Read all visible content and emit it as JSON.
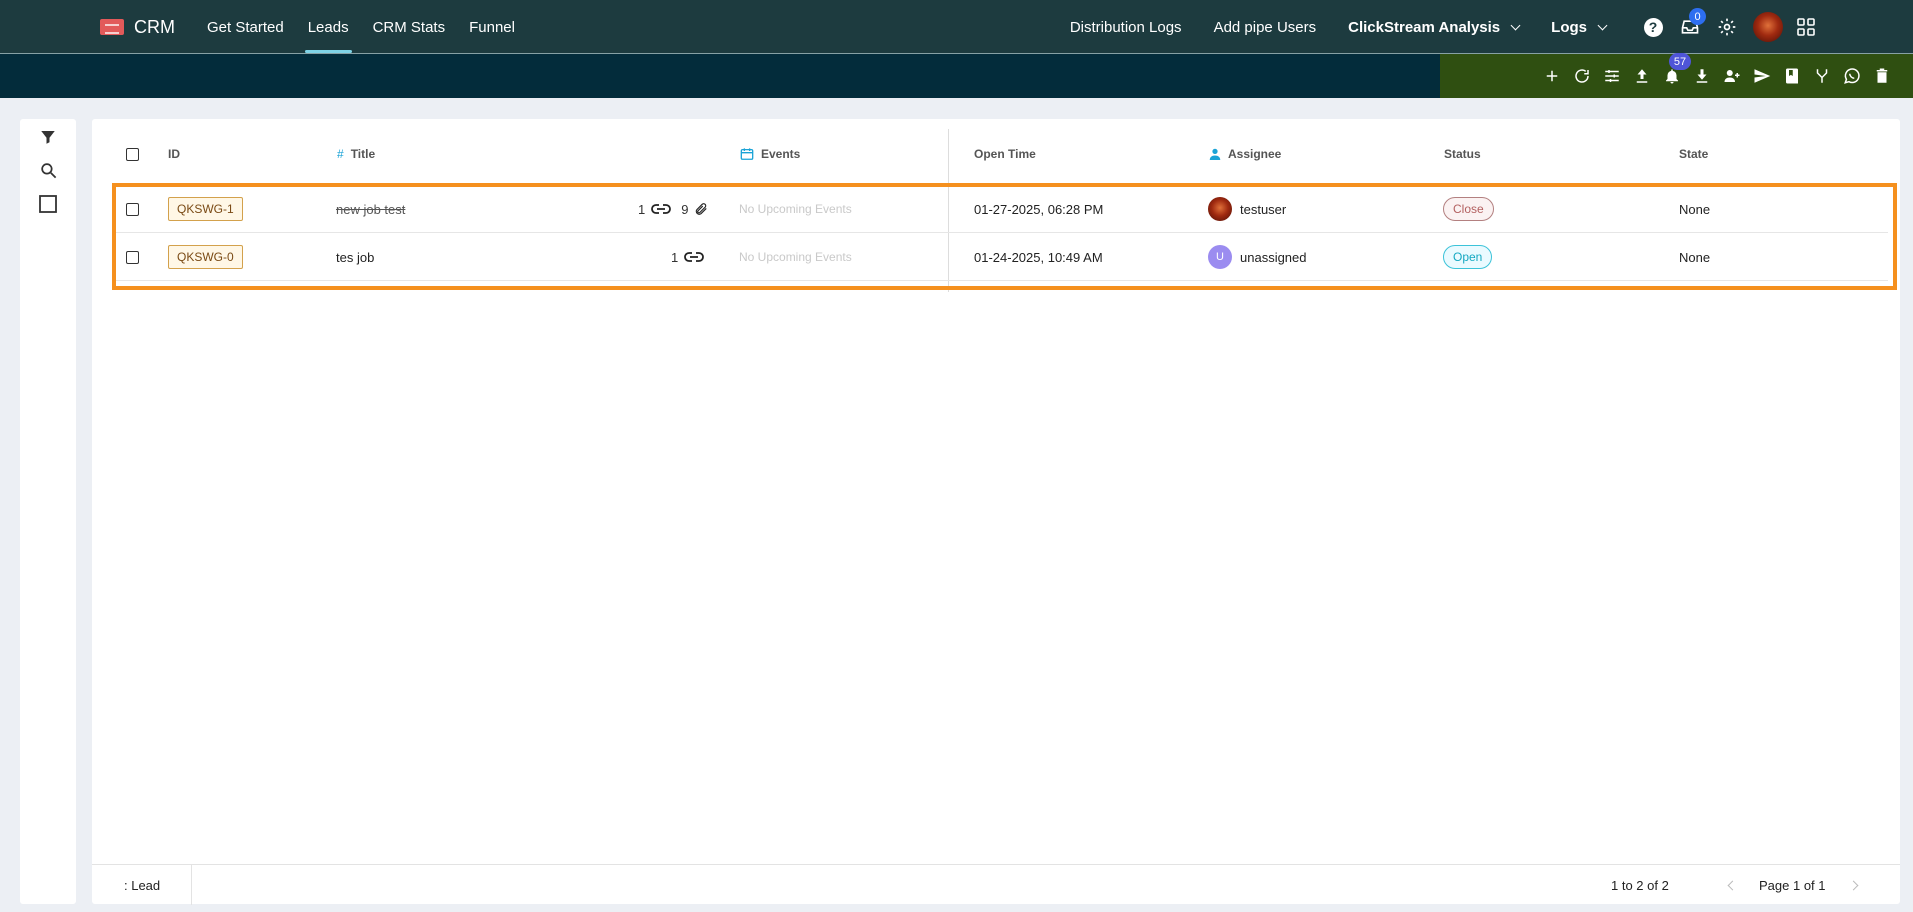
{
  "app": {
    "brand_name": "CRM",
    "nav_left": [
      "Get Started",
      "Leads",
      "CRM Stats",
      "Funnel"
    ],
    "active_tab": "Leads",
    "nav_right": {
      "distribution_logs": "Distribution Logs",
      "add_pipe_users": "Add pipe Users",
      "clickstream": "ClickStream Analysis",
      "logs": "Logs"
    },
    "inbox_count": "0",
    "notification_count": "57"
  },
  "toolbar_icons": [
    "add-icon",
    "refresh-icon",
    "filter-settings-icon",
    "upload-icon",
    "bell-icon",
    "download-icon",
    "add-users-icon",
    "send-icon",
    "book-icon",
    "merge-icon",
    "whatsapp-icon",
    "delete-icon"
  ],
  "table": {
    "headers": {
      "id": "ID",
      "title": "Title",
      "events": "Events",
      "open_time": "Open Time",
      "assignee": "Assignee",
      "status": "Status",
      "state": "State"
    },
    "rows": [
      {
        "id": "QKSWG-1",
        "title": "new job test",
        "title_strike": true,
        "links": "1",
        "attachments": "9",
        "events": "No Upcoming Events",
        "open_time": "01-27-2025, 06:28 PM",
        "assignee": "testuser",
        "assignee_initial": "",
        "status": "Close",
        "state": "None"
      },
      {
        "id": "QKSWG-0",
        "title": "tes job",
        "title_strike": false,
        "links": "1",
        "attachments": "",
        "events": "No Upcoming Events",
        "open_time": "01-24-2025, 10:49 AM",
        "assignee": "unassigned",
        "assignee_initial": "U",
        "status": "Open",
        "state": "None"
      }
    ]
  },
  "footer": {
    "type_label": ": Lead",
    "range": "1 to 2 of 2",
    "page": "Page 1 of 1"
  }
}
